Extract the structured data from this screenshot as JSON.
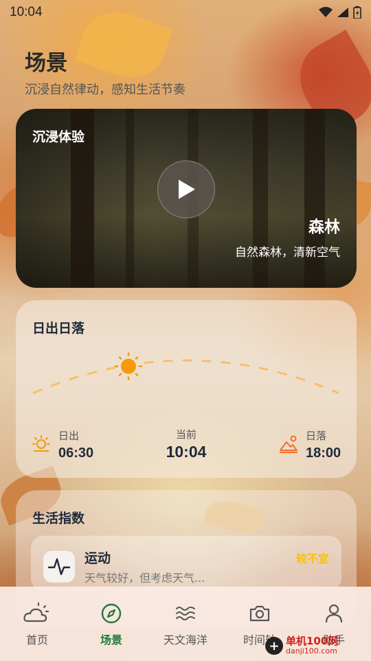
{
  "status_bar": {
    "time": "10:04"
  },
  "header": {
    "title": "场景",
    "subtitle": "沉浸自然律动，感知生活节奏"
  },
  "immersive": {
    "label": "沉浸体验",
    "scene_name": "森林",
    "scene_desc": "自然森林，清新空气"
  },
  "sun": {
    "title": "日出日落",
    "sunrise_label": "日出",
    "sunrise_time": "06:30",
    "now_label": "当前",
    "now_time": "10:04",
    "sunset_label": "日落",
    "sunset_time": "18:00",
    "accent_color": "#f5a623"
  },
  "life_index": {
    "title": "生活指数",
    "items": [
      {
        "name": "运动",
        "desc": "天气较好，但考虑天气...",
        "level": "较不宜",
        "icon": "pulse-icon"
      }
    ]
  },
  "bottom_nav": {
    "items": [
      {
        "label": "首页",
        "icon": "weather-icon",
        "active": false
      },
      {
        "label": "场景",
        "icon": "compass-icon",
        "active": true
      },
      {
        "label": "天文海洋",
        "icon": "waves-icon",
        "active": false
      },
      {
        "label": "时间轴",
        "icon": "camera-icon",
        "active": false
      },
      {
        "label": "助手",
        "icon": "person-icon",
        "active": false
      }
    ],
    "active_color": "#1f7a3a"
  },
  "watermark": {
    "line1": "单机100网",
    "line2": "danji100.com"
  }
}
